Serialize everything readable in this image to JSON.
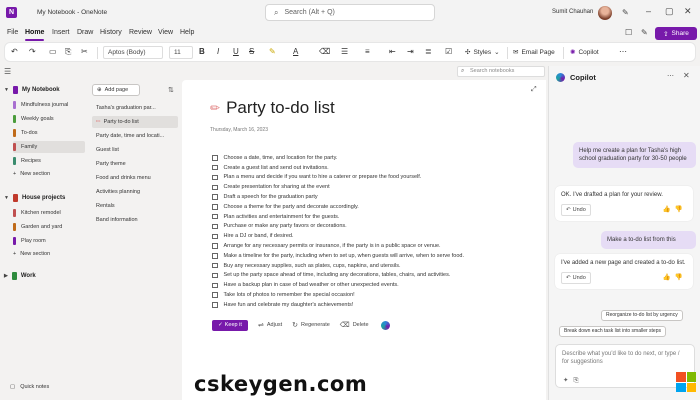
{
  "titlebar": {
    "app_icon": "N",
    "doc_title": "My Notebook - OneNote",
    "search_placeholder": "Search (Alt + Q)",
    "user_name": "Sumit Chauhan"
  },
  "menu": {
    "items": [
      "File",
      "Home",
      "Insert",
      "Draw",
      "History",
      "Review",
      "View",
      "Help"
    ],
    "share_label": "Share"
  },
  "toolbar": {
    "font_name": "Aptos (Body)",
    "font_size": "11",
    "styles_label": "Styles",
    "email_page_label": "Email Page",
    "copilot_label": "Copilot"
  },
  "search_notebooks": {
    "placeholder": "Search notebooks"
  },
  "nav": {
    "notebooks": [
      {
        "name": "My Notebook",
        "color": "#7719aa",
        "sections": [
          {
            "label": "Mindfulness journal",
            "color": "#a86fd0"
          },
          {
            "label": "Weekly goals",
            "color": "#4a9c3b"
          },
          {
            "label": "To-dos",
            "color": "#c06b1a"
          },
          {
            "label": "Family",
            "color": "#c05050"
          },
          {
            "label": "Recipes",
            "color": "#3b8c6e"
          }
        ],
        "new_section": "New section"
      },
      {
        "name": "House projects",
        "color": "#c0392b",
        "sections": [
          {
            "label": "Kitchen remodel",
            "color": "#c05050"
          },
          {
            "label": "Garden and yard",
            "color": "#c06b1a"
          },
          {
            "label": "Play room",
            "color": "#7719aa"
          }
        ],
        "new_section": "New section"
      },
      {
        "name": "Work",
        "color": "#2e8b3d"
      }
    ],
    "quick_notes": "Quick notes"
  },
  "pagelist": {
    "add_page": "Add page",
    "pages": [
      "Tasha's graduation par...",
      "Party to-do list",
      "Party date, time and locati...",
      "Guest list",
      "Party theme",
      "Food and drinks menu",
      "Activities planning",
      "Rentals",
      "Band information"
    ]
  },
  "page": {
    "title": "Party to-do list",
    "date": "Thursday, March 16, 2023",
    "todos": [
      "Choose a date, time, and location for the party.",
      "Create a guest list and send out invitations.",
      "Plan a menu and decide if you want to hire a caterer or prepare the food yourself.",
      "Create presentation for sharing at the event",
      "Draft a speech for the graduation party",
      "Choose a theme for the party and decorate accordingly.",
      "Plan activities and entertainment for the guests.",
      "Purchase or make any party favors or decorations.",
      "Hire a DJ or band, if desired.",
      "Arrange for any necessary permits or insurance, if the party is in a public space or venue.",
      "Make a timeline for the party, including when to set up, when guests will arrive, when to serve food.",
      "Buy any necessary supplies, such as plates, cups, napkins, and utensils.",
      "Set up the party space ahead of time, including any decorations, tables, chairs, and activities.",
      "Have a backup plan in case of bad weather or other unexpected events.",
      "Take lots of photos to remember the special occasion!",
      "Have fun and celebrate my daughter's achievements!"
    ],
    "actions": {
      "keep": "Keep it",
      "adjust": "Adjust",
      "regenerate": "Regenerate",
      "delete": "Delete"
    }
  },
  "copilot": {
    "title": "Copilot",
    "messages": [
      {
        "role": "user",
        "text": "Help me create a plan for Tasha's high school graduation party for 30-50 people"
      },
      {
        "role": "ai",
        "text": "OK. I've drafted a plan for your review.",
        "undo": "Undo"
      },
      {
        "role": "user",
        "text": "Make a to-do list from this"
      },
      {
        "role": "ai",
        "text": "I've added a new page and created a to-do list.",
        "undo": "Undo"
      }
    ],
    "suggestions": [
      "Reorganize to-do list by urgency",
      "Break down each task list into smaller steps"
    ],
    "input_placeholder": "Describe what you'd like to do next, or type / for suggestions"
  },
  "watermark": "cskeygen.com"
}
